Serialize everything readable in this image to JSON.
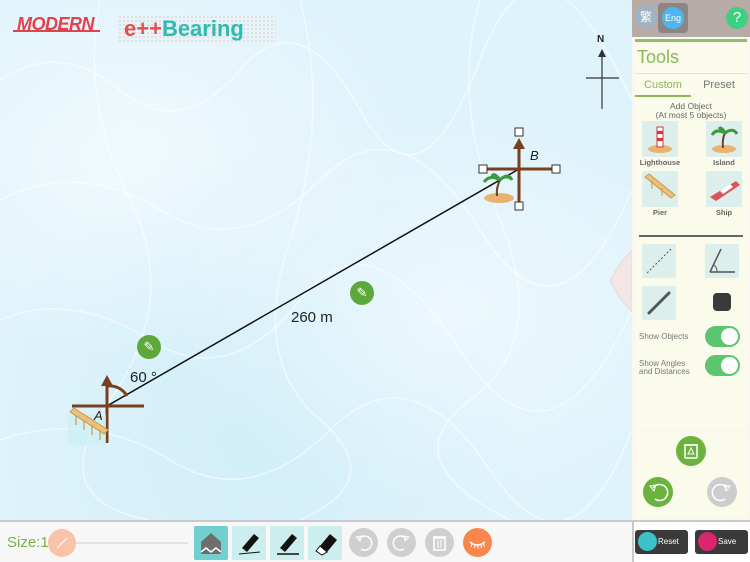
{
  "header": {
    "logo": "MODERN",
    "app_title_prefix": "e++",
    "app_title": "Bearing"
  },
  "canvas": {
    "compass_label": "N",
    "points": [
      {
        "label": "A",
        "object": "Pier"
      },
      {
        "label": "B",
        "object": "Island"
      }
    ],
    "angle_label": "60 °",
    "distance_label": "260 m"
  },
  "sidebar": {
    "lang_zh": "繁",
    "lang_en": "Eng",
    "help": "?",
    "title": "Tools",
    "tabs": [
      {
        "label": "Custom",
        "active": true
      },
      {
        "label": "Preset",
        "active": false
      }
    ],
    "add_object_line1": "Add Object",
    "add_object_line2": "(At most 5 objects)",
    "objects": [
      {
        "label": "Lighthouse"
      },
      {
        "label": "Island"
      },
      {
        "label": "Pier"
      },
      {
        "label": "Ship"
      }
    ],
    "tools": [
      "dashed-line",
      "angle",
      "solid-line",
      "color-swatch"
    ],
    "switches": [
      {
        "label": "Show Objects",
        "on": true
      },
      {
        "label_line1": "Show Angles",
        "label_line2": "and Distances",
        "on": true
      }
    ],
    "reset_label": "Reset",
    "save_label": "Save"
  },
  "bottombar": {
    "size_label": "Size:1",
    "size_value": 1
  },
  "colors": {
    "accent_green": "#8ab857",
    "bearing_brown": "#7a3f1c",
    "toolbar_teal": "#73cfcf",
    "reset_teal": "#3cc3c9",
    "save_pink": "#d9266e",
    "eye_orange": "#f9864a"
  }
}
